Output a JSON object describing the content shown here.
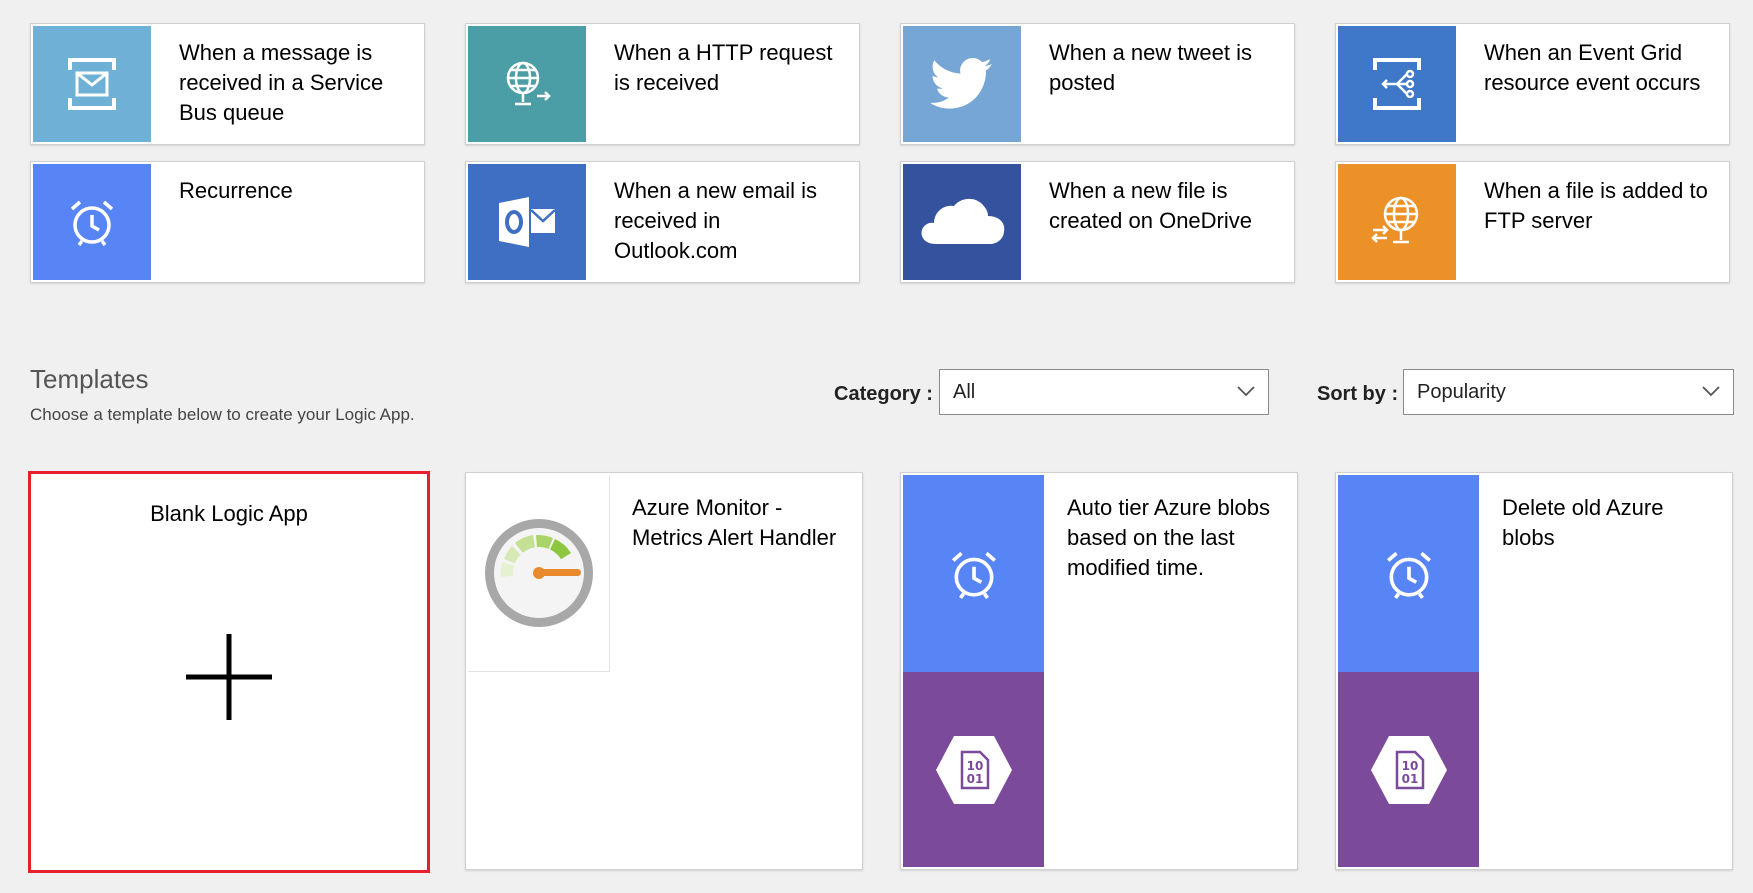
{
  "triggers": [
    {
      "label": "When a message is received in a Service Bus queue",
      "color": "#6fb1d6",
      "icon": "service-bus-icon"
    },
    {
      "label": "When a HTTP request is received",
      "color": "#4b9ea5",
      "icon": "http-globe-icon"
    },
    {
      "label": "When a new tweet is posted",
      "color": "#75a6d6",
      "icon": "twitter-bird-icon"
    },
    {
      "label": "When an Event Grid resource event occurs",
      "color": "#3f78c9",
      "icon": "event-grid-icon"
    },
    {
      "label": "Recurrence",
      "color": "#5785f5",
      "icon": "alarm-clock-icon"
    },
    {
      "label": "When a new email is received in Outlook.com",
      "color": "#3f6fc2",
      "icon": "outlook-icon"
    },
    {
      "label": "When a new file is created on OneDrive",
      "color": "#34529d",
      "icon": "onedrive-cloud-icon"
    },
    {
      "label": "When a file is added to FTP server",
      "color": "#ec9128",
      "icon": "ftp-globe-icon"
    }
  ],
  "templates_section": {
    "title": "Templates",
    "subtitle": "Choose a template below to create your Logic App.",
    "category_label": "Category :",
    "category_value": "All",
    "sort_label": "Sort by :",
    "sort_value": "Popularity"
  },
  "templates": {
    "blank": {
      "label": "Blank Logic App",
      "icon": "plus-icon",
      "highlight_color": "#e8202a"
    },
    "azure_monitor": {
      "label": "Azure Monitor - Metrics Alert Handler",
      "icon": "speedometer-icon"
    },
    "auto_tier": {
      "label": "Auto tier Azure blobs based on the last modified time.",
      "top_color": "#5785f5",
      "bottom_color": "#7b4a9b",
      "icons": [
        "alarm-clock-icon",
        "blob-storage-icon"
      ]
    },
    "delete_blobs": {
      "label": "Delete old Azure blobs",
      "top_color": "#5785f5",
      "bottom_color": "#7b4a9b",
      "icons": [
        "alarm-clock-icon",
        "blob-storage-icon"
      ]
    }
  }
}
